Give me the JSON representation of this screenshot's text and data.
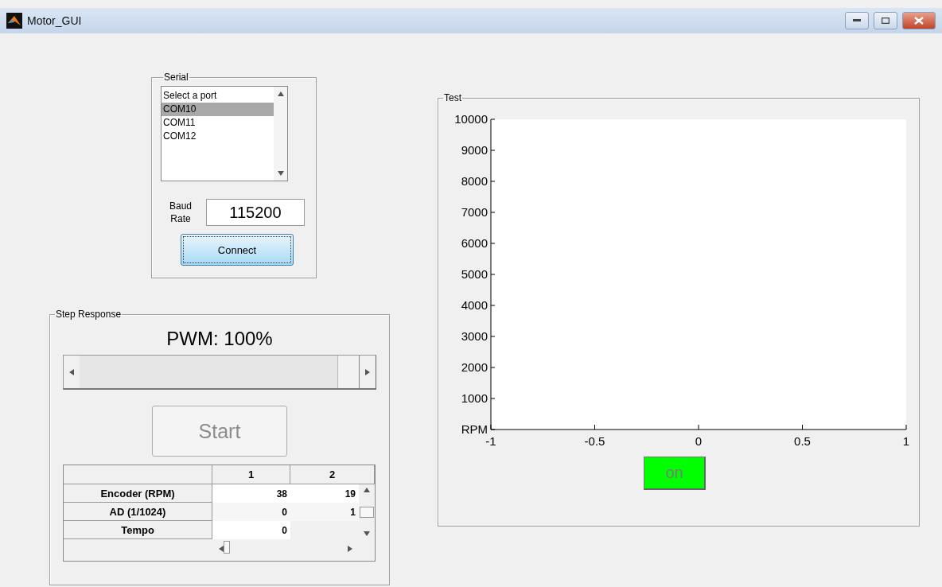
{
  "window": {
    "title": "Motor_GUI"
  },
  "serial": {
    "title": "Serial",
    "ports": [
      {
        "label": "Select a port",
        "selected": false
      },
      {
        "label": "COM10",
        "selected": true
      },
      {
        "label": "COM11",
        "selected": false
      },
      {
        "label": "COM12",
        "selected": false
      }
    ],
    "baud_label": "Baud Rate",
    "baud_value": "115200",
    "connect_button": "Connect"
  },
  "step_response": {
    "title": "Step Response",
    "pwm_label": "PWM: 100%",
    "slider": {
      "level": 1.0
    },
    "start_button": {
      "label": "Start",
      "disabled": true
    },
    "table": {
      "columns": [
        "1",
        "2"
      ],
      "rows": [
        {
          "label": "Encoder (RPM)",
          "values": [
            "38",
            "19"
          ]
        },
        {
          "label": "AD (1/1024)",
          "values": [
            "0",
            "1"
          ]
        },
        {
          "label": "Tempo",
          "values": [
            "0"
          ]
        }
      ]
    }
  },
  "test": {
    "title": "Test",
    "chart_data": {
      "type": "line",
      "xlim": [
        -1,
        1
      ],
      "ylim": [
        0,
        10000
      ],
      "xticks": [
        {
          "value": -1,
          "label": "-1"
        },
        {
          "value": -0.5,
          "label": "-0.5"
        },
        {
          "value": 0,
          "label": "0"
        },
        {
          "value": 0.5,
          "label": "0.5"
        },
        {
          "value": 1,
          "label": "1"
        }
      ],
      "yticks": [
        {
          "value": 0,
          "label": "RPM"
        },
        {
          "value": 1000,
          "label": "1000"
        },
        {
          "value": 2000,
          "label": "2000"
        },
        {
          "value": 3000,
          "label": "3000"
        },
        {
          "value": 4000,
          "label": "4000"
        },
        {
          "value": 5000,
          "label": "5000"
        },
        {
          "value": 6000,
          "label": "6000"
        },
        {
          "value": 7000,
          "label": "7000"
        },
        {
          "value": 8000,
          "label": "8000"
        },
        {
          "value": 9000,
          "label": "9000"
        },
        {
          "value": 10000,
          "label": "10000"
        }
      ]
    },
    "on_button": {
      "label": "on",
      "on": true
    }
  }
}
